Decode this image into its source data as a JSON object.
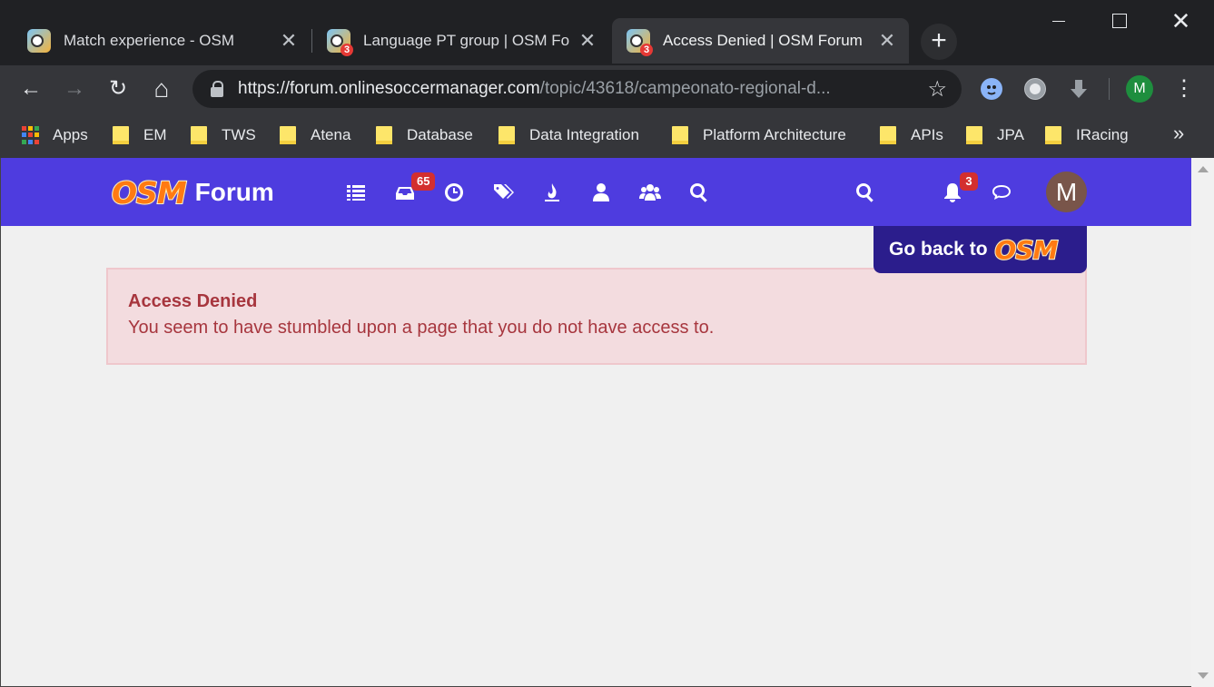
{
  "tabs": [
    {
      "title": "Match experience - OSM",
      "badge": ""
    },
    {
      "title": "Language PT group | OSM Forum",
      "badge": "3"
    },
    {
      "title": "Access Denied | OSM Forum",
      "badge": "3"
    }
  ],
  "tab_close_glyph": "✕",
  "new_tab_glyph": "+",
  "window_close_glyph": "✕",
  "toolbar": {
    "back_icon": "←",
    "forward_icon": "→",
    "reload_icon": "↻",
    "home_icon": "⌂",
    "star_icon": "☆",
    "menu_icon": "⋮",
    "profile_letter": "M"
  },
  "omnibox": {
    "host": "https://forum.onlinesoccermanager.com",
    "path": "/topic/43618/campeonato-regional-d..."
  },
  "bookmarks": {
    "apps": "Apps",
    "folders": [
      "EM",
      "TWS",
      "Atena",
      "Database",
      "Data Integration",
      "Platform Architecture",
      "APIs",
      "JPA",
      "IRacing"
    ],
    "more": "»"
  },
  "forum": {
    "logo_text": "OSM",
    "forum_label": "Forum",
    "unread_badge": "65",
    "notifications_badge": "3",
    "avatar_letter": "M",
    "go_back_label": "Go back to",
    "go_back_logo": "OSM"
  },
  "alert": {
    "title": "Access Denied",
    "message": "You seem to have stumbled upon a page that you do not have access to."
  },
  "colors": {
    "navbar": "#4e3cdf",
    "alert_bg": "#f3dcdf",
    "alert_text": "#a7363e",
    "badge": "#d32f2f"
  }
}
